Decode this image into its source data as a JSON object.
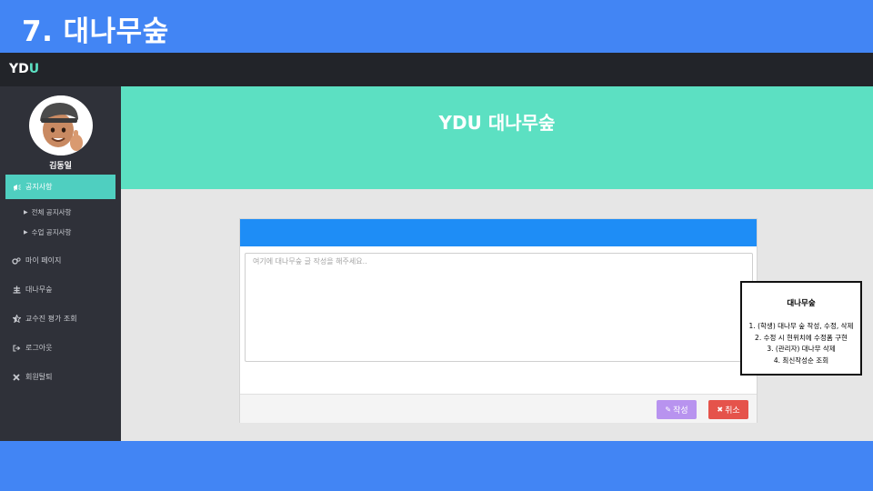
{
  "slide": {
    "title": "7. 대나무숲"
  },
  "topbar": {
    "brand_main": "YD",
    "brand_accent": "U"
  },
  "sidebar": {
    "username": "김동일",
    "items": [
      {
        "label": "공지사항",
        "icon": "megaphone-icon",
        "active": true
      },
      {
        "label": "마이 페이지",
        "icon": "cogs-icon"
      },
      {
        "label": "대나무숲",
        "icon": "bamboo-icon"
      },
      {
        "label": "교수진 평가 조회",
        "icon": "star-half-icon"
      },
      {
        "label": "로그아웃",
        "icon": "sign-out-icon"
      },
      {
        "label": "회원탈퇴",
        "icon": "close-icon"
      }
    ],
    "sub_items": [
      {
        "label": "전체 공지사항"
      },
      {
        "label": "수업 공지사항"
      }
    ]
  },
  "hero": {
    "title": "YDU 대나무숲"
  },
  "editor": {
    "placeholder": "여기에 대나무숲 글 작성을 해주세요..",
    "value": "",
    "write_label": "작성",
    "cancel_label": "취소"
  },
  "note": {
    "title": "대나무숲",
    "lines": [
      "1. (학생) 대나무 숲 작성, 수정, 삭제",
      "2. 수정 시 현위치에 수정폼 구현",
      "3. (관리자) 대나무 삭제",
      "4. 최신작성순 조회"
    ]
  },
  "colors": {
    "slide_bg": "#4285f4",
    "topbar": "#222429",
    "sidebar": "#2f3139",
    "sidebar_active": "#4fcfc0",
    "hero": "#5ce0c2",
    "card_header": "#1e8df6",
    "write_button": "#b893ef",
    "cancel_button": "#e5534b"
  }
}
